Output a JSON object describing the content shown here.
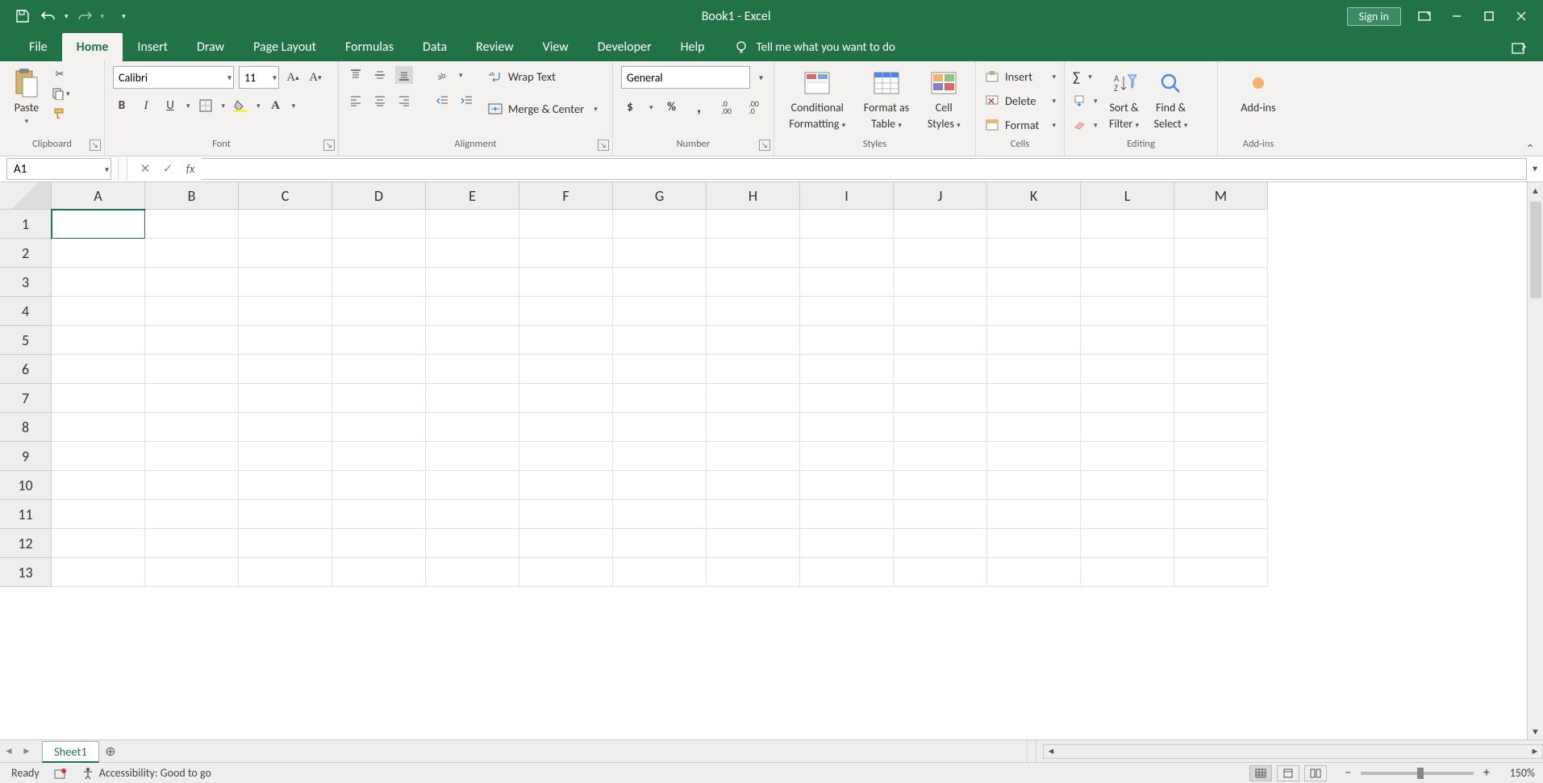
{
  "title": "Book1  -  Excel",
  "signin": "Sign in",
  "tabs": {
    "file": "File",
    "home": "Home",
    "insert": "Insert",
    "draw": "Draw",
    "pagelayout": "Page Layout",
    "formulas": "Formulas",
    "data": "Data",
    "review": "Review",
    "view": "View",
    "developer": "Developer",
    "help": "Help",
    "tellme": "Tell me what you want to do"
  },
  "ribbon": {
    "clipboard": {
      "label": "Clipboard",
      "paste": "Paste"
    },
    "font": {
      "label": "Font",
      "name": "Calibri",
      "size": "11"
    },
    "alignment": {
      "label": "Alignment",
      "wrap": "Wrap Text",
      "merge": "Merge & Center"
    },
    "number": {
      "label": "Number",
      "format": "General"
    },
    "styles": {
      "label": "Styles",
      "cond1": "Conditional",
      "cond2": "Formatting",
      "fat1": "Format as",
      "fat2": "Table",
      "cst1": "Cell",
      "cst2": "Styles"
    },
    "cells": {
      "label": "Cells",
      "insert": "Insert",
      "delete": "Delete",
      "format": "Format"
    },
    "editing": {
      "label": "Editing",
      "sort1": "Sort &",
      "sort2": "Filter",
      "find1": "Find &",
      "find2": "Select"
    },
    "addins": {
      "label": "Add-ins",
      "btn": "Add-ins"
    }
  },
  "formula": {
    "namebox": "A1",
    "value": ""
  },
  "columns": [
    "A",
    "B",
    "C",
    "D",
    "E",
    "F",
    "G",
    "H",
    "I",
    "J",
    "K",
    "L",
    "M"
  ],
  "rows": [
    "1",
    "2",
    "3",
    "4",
    "5",
    "6",
    "7",
    "8",
    "9",
    "10",
    "11",
    "12",
    "13"
  ],
  "sheet": {
    "name": "Sheet1"
  },
  "status": {
    "ready": "Ready",
    "access": "Accessibility: Good to go",
    "zoom": "150%"
  }
}
